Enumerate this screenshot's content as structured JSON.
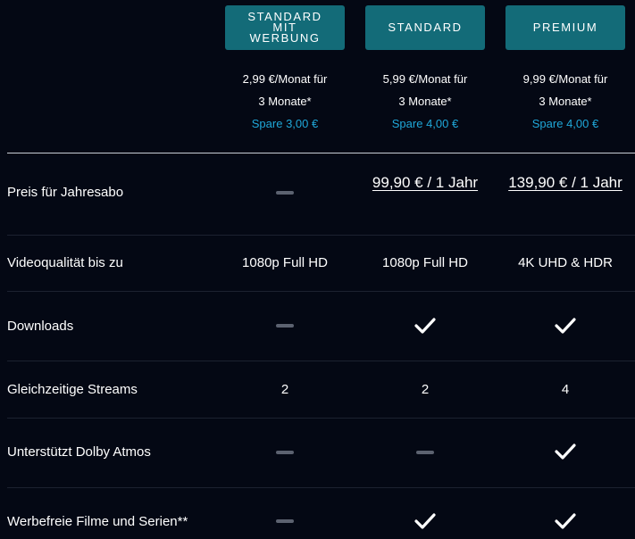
{
  "plans": [
    {
      "label_lines": [
        "STANDARD",
        "MIT",
        "WERBUNG"
      ],
      "price": "2,99 €/Monat für",
      "duration": "3 Monate*",
      "savings": "Spare 3,00 €"
    },
    {
      "label_lines": [
        "STANDARD"
      ],
      "price": "5,99 €/Monat für",
      "duration": "3 Monate*",
      "savings": "Spare 4,00 €"
    },
    {
      "label_lines": [
        "PREMIUM"
      ],
      "price": "9,99 €/Monat für",
      "duration": "3 Monate*",
      "savings": "Spare 4,00 €"
    }
  ],
  "rows": {
    "yearly": {
      "label": "Preis für Jahresabo",
      "values": [
        null,
        "99,90 € / 1 Jahr",
        "139,90 € / 1 Jahr"
      ]
    },
    "quality": {
      "label": "Videoqualität bis zu",
      "values": [
        "1080p Full HD",
        "1080p Full HD",
        "4K UHD & HDR"
      ]
    },
    "downloads": {
      "label": "Downloads",
      "values": [
        "dash-icon",
        "check-icon",
        "check-icon"
      ]
    },
    "streams": {
      "label": "Gleichzeitige Streams",
      "values": [
        "2",
        "2",
        "4"
      ]
    },
    "dolby": {
      "label": "Unterstützt Dolby Atmos",
      "values": [
        "dash-icon",
        "dash-icon",
        "check-icon"
      ]
    },
    "adfree": {
      "label": "Werbefreie Filme und Serien**",
      "values": [
        "dash-icon",
        "check-icon",
        "check-icon"
      ]
    }
  },
  "colors": {
    "background": "#040814",
    "plan_button": "#136b78",
    "savings_text": "#1fa7d8",
    "dash": "#5c6270"
  }
}
